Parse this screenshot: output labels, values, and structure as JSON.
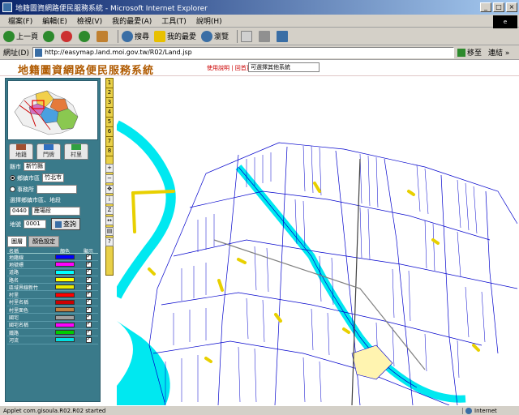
{
  "window": {
    "title": "地籍圖資網路便民服務系統 - Microsoft Internet Explorer"
  },
  "menubar": {
    "items": [
      "檔案(F)",
      "編輯(E)",
      "檢視(V)",
      "我的最愛(A)",
      "工具(T)",
      "說明(H)"
    ]
  },
  "toolbar": {
    "back": "上一頁",
    "search": "搜尋",
    "favorites": "我的最愛",
    "history": "瀏覽"
  },
  "address": {
    "label": "網址(D)",
    "url": "http://easymap.land.moi.gov.tw/R02/Land.jsp",
    "go": "移至",
    "links": "連結 »"
  },
  "page": {
    "site_title": "地籍圖資網路便民服務系統",
    "header_links": "使用說明 | 回首頁",
    "header_select": "可選擇其他系統"
  },
  "left": {
    "tabs": [
      "地籍",
      "門牌",
      "村里"
    ],
    "query": {
      "county_label": "縣市",
      "county_value": "新竹縣",
      "radio1_label": "鄉鎮市區",
      "radio1_value": "竹北市",
      "radio2_label": "事務所",
      "section_label": "選擇鄉鎮市區、地段",
      "section_code": "0440",
      "section_value": "鹿場段",
      "parcel_label": "地號",
      "parcel_value": "0001",
      "query_button": "查詢"
    },
    "layer_tabs": [
      "圖層",
      "顏色設定"
    ],
    "layer_headers": [
      "名稱",
      "顏色",
      "顯示"
    ],
    "layers": [
      {
        "name": "地籍線",
        "color": "#0000ff"
      },
      {
        "name": "地號標",
        "color": "#ff00ff"
      },
      {
        "name": "道路",
        "color": "#00ffff"
      },
      {
        "name": "路名",
        "color": "#ffff00"
      },
      {
        "name": "區域界線新竹",
        "color": "#e8e800"
      },
      {
        "name": "村里",
        "color": "#ff0000"
      },
      {
        "name": "村里名稱",
        "color": "#cc0000"
      },
      {
        "name": "村里面色",
        "color": "#c08040"
      },
      {
        "name": "國宅",
        "color": "#a0a0a0"
      },
      {
        "name": "國宅名稱",
        "color": "#ff00ff"
      },
      {
        "name": "鐵路",
        "color": "#00cc00"
      },
      {
        "name": "河流",
        "color": "#00e0e0"
      }
    ]
  },
  "scale_buttons": [
    "1",
    "2",
    "3",
    "4",
    "5",
    "6",
    "7",
    "8"
  ],
  "status": {
    "text": "Applet com.gisoula.R02.R02 started",
    "zone": "Internet"
  },
  "colors": {
    "parcel_line": "#0000cc",
    "river": "#00e8f0",
    "road_label": "#e8d000",
    "panel": "#3a7a8a"
  }
}
